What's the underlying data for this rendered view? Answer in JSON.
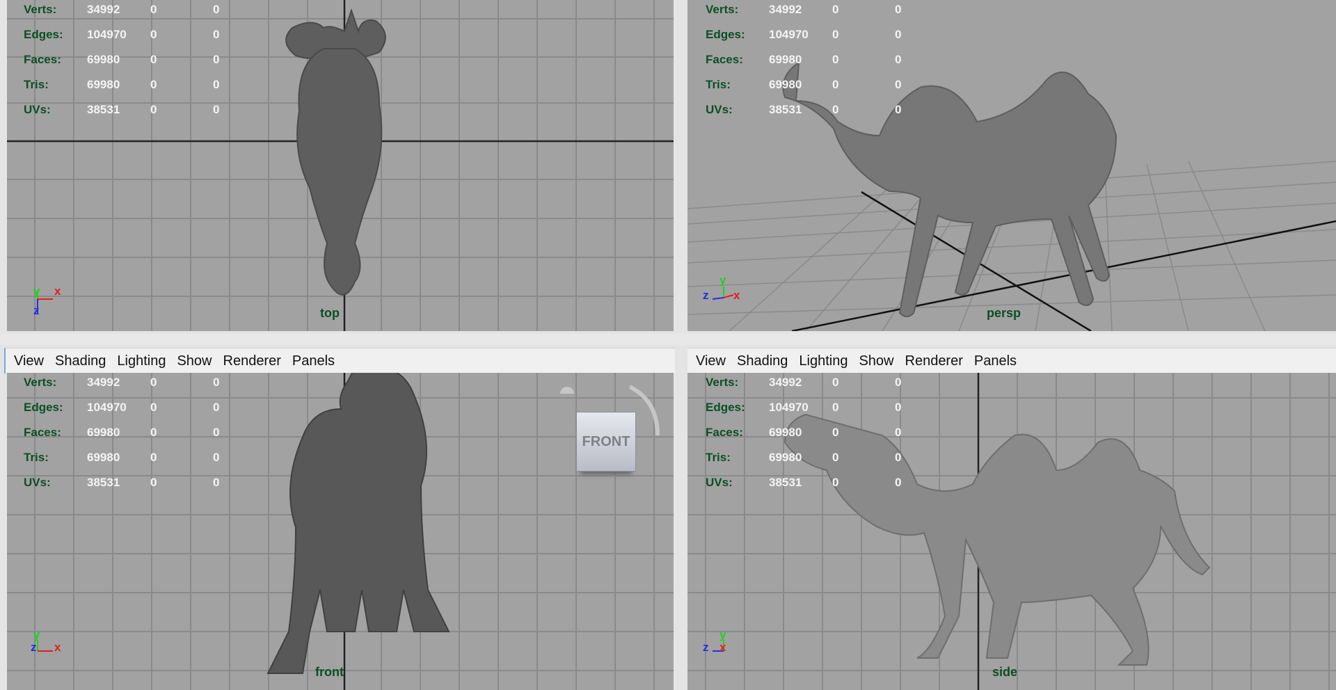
{
  "hud": {
    "rows": [
      {
        "label": "Verts:",
        "v1": "34992",
        "v2": "0",
        "v3": "0"
      },
      {
        "label": "Edges:",
        "v1": "104970",
        "v2": "0",
        "v3": "0"
      },
      {
        "label": "Faces:",
        "v1": "69980",
        "v2": "0",
        "v3": "0"
      },
      {
        "label": "Tris:",
        "v1": "69980",
        "v2": "0",
        "v3": "0"
      },
      {
        "label": "UVs:",
        "v1": "38531",
        "v2": "0",
        "v3": "0"
      }
    ]
  },
  "menu": {
    "items": [
      "View",
      "Shading",
      "Lighting",
      "Show",
      "Renderer",
      "Panels"
    ]
  },
  "viewports": {
    "top": {
      "camera": "top"
    },
    "persp": {
      "camera": "persp"
    },
    "front": {
      "camera": "front",
      "viewcube": "FRONT"
    },
    "side": {
      "camera": "side"
    }
  },
  "axes": {
    "x": "x",
    "y": "y",
    "z": "z"
  },
  "colors": {
    "viewport_bg": "#a2a2a2",
    "grid": "#8a8a8a",
    "grid_axis": "#222222",
    "hud_label": "#0b4f26",
    "hud_value": "#f4f4f4",
    "axis_x": "#e02020",
    "axis_y": "#20d020",
    "axis_z": "#2030e0"
  }
}
